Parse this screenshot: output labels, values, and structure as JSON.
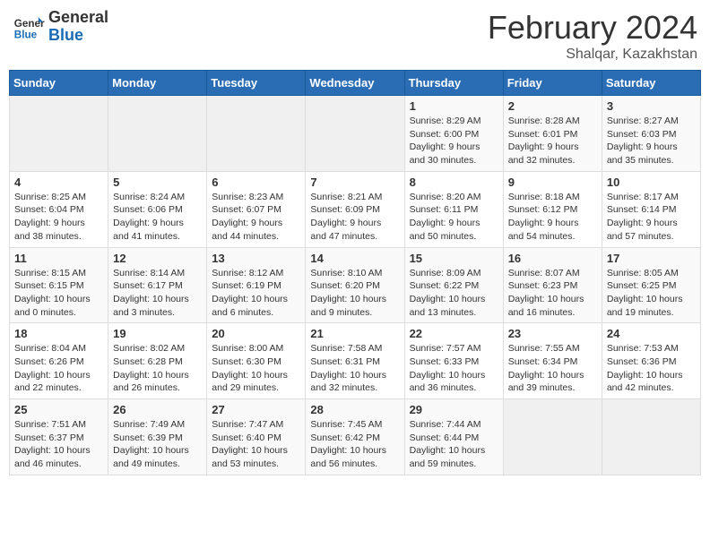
{
  "header": {
    "logo_general": "General",
    "logo_blue": "Blue",
    "month_year": "February 2024",
    "location": "Shalqar, Kazakhstan"
  },
  "days_of_week": [
    "Sunday",
    "Monday",
    "Tuesday",
    "Wednesday",
    "Thursday",
    "Friday",
    "Saturday"
  ],
  "weeks": [
    [
      {
        "day": "",
        "info": ""
      },
      {
        "day": "",
        "info": ""
      },
      {
        "day": "",
        "info": ""
      },
      {
        "day": "",
        "info": ""
      },
      {
        "day": "1",
        "info": "Sunrise: 8:29 AM\nSunset: 6:00 PM\nDaylight: 9 hours and 30 minutes."
      },
      {
        "day": "2",
        "info": "Sunrise: 8:28 AM\nSunset: 6:01 PM\nDaylight: 9 hours and 32 minutes."
      },
      {
        "day": "3",
        "info": "Sunrise: 8:27 AM\nSunset: 6:03 PM\nDaylight: 9 hours and 35 minutes."
      }
    ],
    [
      {
        "day": "4",
        "info": "Sunrise: 8:25 AM\nSunset: 6:04 PM\nDaylight: 9 hours and 38 minutes."
      },
      {
        "day": "5",
        "info": "Sunrise: 8:24 AM\nSunset: 6:06 PM\nDaylight: 9 hours and 41 minutes."
      },
      {
        "day": "6",
        "info": "Sunrise: 8:23 AM\nSunset: 6:07 PM\nDaylight: 9 hours and 44 minutes."
      },
      {
        "day": "7",
        "info": "Sunrise: 8:21 AM\nSunset: 6:09 PM\nDaylight: 9 hours and 47 minutes."
      },
      {
        "day": "8",
        "info": "Sunrise: 8:20 AM\nSunset: 6:11 PM\nDaylight: 9 hours and 50 minutes."
      },
      {
        "day": "9",
        "info": "Sunrise: 8:18 AM\nSunset: 6:12 PM\nDaylight: 9 hours and 54 minutes."
      },
      {
        "day": "10",
        "info": "Sunrise: 8:17 AM\nSunset: 6:14 PM\nDaylight: 9 hours and 57 minutes."
      }
    ],
    [
      {
        "day": "11",
        "info": "Sunrise: 8:15 AM\nSunset: 6:15 PM\nDaylight: 10 hours and 0 minutes."
      },
      {
        "day": "12",
        "info": "Sunrise: 8:14 AM\nSunset: 6:17 PM\nDaylight: 10 hours and 3 minutes."
      },
      {
        "day": "13",
        "info": "Sunrise: 8:12 AM\nSunset: 6:19 PM\nDaylight: 10 hours and 6 minutes."
      },
      {
        "day": "14",
        "info": "Sunrise: 8:10 AM\nSunset: 6:20 PM\nDaylight: 10 hours and 9 minutes."
      },
      {
        "day": "15",
        "info": "Sunrise: 8:09 AM\nSunset: 6:22 PM\nDaylight: 10 hours and 13 minutes."
      },
      {
        "day": "16",
        "info": "Sunrise: 8:07 AM\nSunset: 6:23 PM\nDaylight: 10 hours and 16 minutes."
      },
      {
        "day": "17",
        "info": "Sunrise: 8:05 AM\nSunset: 6:25 PM\nDaylight: 10 hours and 19 minutes."
      }
    ],
    [
      {
        "day": "18",
        "info": "Sunrise: 8:04 AM\nSunset: 6:26 PM\nDaylight: 10 hours and 22 minutes."
      },
      {
        "day": "19",
        "info": "Sunrise: 8:02 AM\nSunset: 6:28 PM\nDaylight: 10 hours and 26 minutes."
      },
      {
        "day": "20",
        "info": "Sunrise: 8:00 AM\nSunset: 6:30 PM\nDaylight: 10 hours and 29 minutes."
      },
      {
        "day": "21",
        "info": "Sunrise: 7:58 AM\nSunset: 6:31 PM\nDaylight: 10 hours and 32 minutes."
      },
      {
        "day": "22",
        "info": "Sunrise: 7:57 AM\nSunset: 6:33 PM\nDaylight: 10 hours and 36 minutes."
      },
      {
        "day": "23",
        "info": "Sunrise: 7:55 AM\nSunset: 6:34 PM\nDaylight: 10 hours and 39 minutes."
      },
      {
        "day": "24",
        "info": "Sunrise: 7:53 AM\nSunset: 6:36 PM\nDaylight: 10 hours and 42 minutes."
      }
    ],
    [
      {
        "day": "25",
        "info": "Sunrise: 7:51 AM\nSunset: 6:37 PM\nDaylight: 10 hours and 46 minutes."
      },
      {
        "day": "26",
        "info": "Sunrise: 7:49 AM\nSunset: 6:39 PM\nDaylight: 10 hours and 49 minutes."
      },
      {
        "day": "27",
        "info": "Sunrise: 7:47 AM\nSunset: 6:40 PM\nDaylight: 10 hours and 53 minutes."
      },
      {
        "day": "28",
        "info": "Sunrise: 7:45 AM\nSunset: 6:42 PM\nDaylight: 10 hours and 56 minutes."
      },
      {
        "day": "29",
        "info": "Sunrise: 7:44 AM\nSunset: 6:44 PM\nDaylight: 10 hours and 59 minutes."
      },
      {
        "day": "",
        "info": ""
      },
      {
        "day": "",
        "info": ""
      }
    ]
  ]
}
